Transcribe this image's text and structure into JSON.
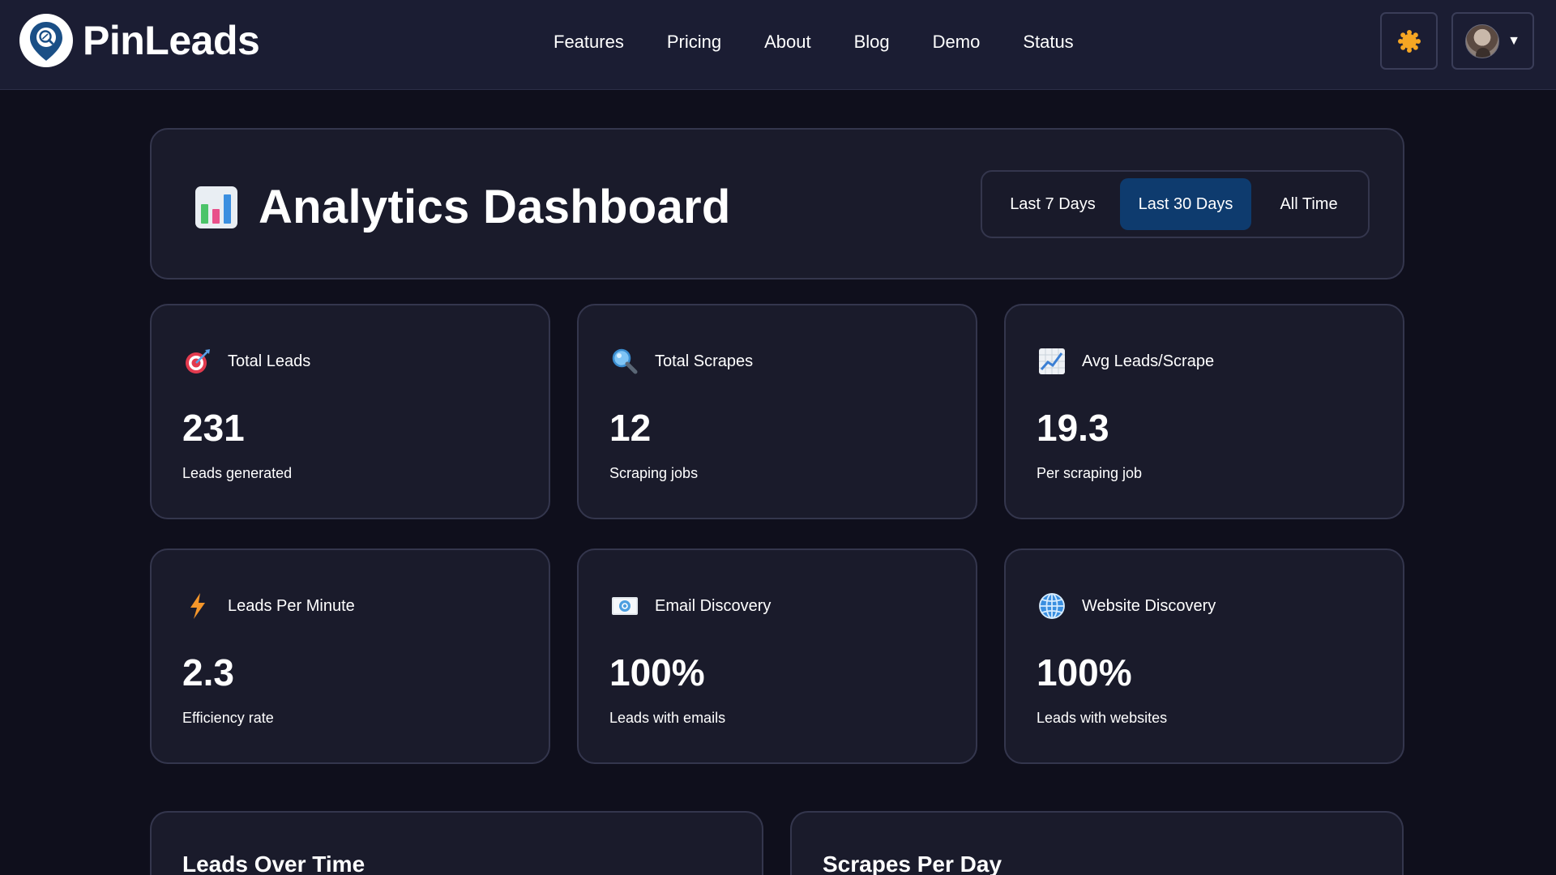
{
  "brand": {
    "name": "PinLeads",
    "logo_icon": "map-pin-search-icon"
  },
  "nav": {
    "links": [
      "Features",
      "Pricing",
      "About",
      "Blog",
      "Demo",
      "Status"
    ]
  },
  "header_actions": {
    "theme_icon": "sun-icon",
    "user_menu_icon": "chevron-down-icon",
    "caret": "▼"
  },
  "dashboard": {
    "title": "Analytics Dashboard",
    "title_icon": "bar-chart-icon",
    "ranges": [
      "Last 7 Days",
      "Last 30 Days",
      "All Time"
    ],
    "active_range": "Last 30 Days"
  },
  "stats": [
    {
      "icon": "target-icon",
      "label": "Total Leads",
      "value": "231",
      "sub": "Leads generated"
    },
    {
      "icon": "magnifier-icon",
      "label": "Total Scrapes",
      "value": "12",
      "sub": "Scraping jobs"
    },
    {
      "icon": "trend-chart-icon",
      "label": "Avg Leads/Scrape",
      "value": "19.3",
      "sub": "Per scraping job"
    },
    {
      "icon": "lightning-icon",
      "label": "Leads Per Minute",
      "value": "2.3",
      "sub": "Efficiency rate"
    },
    {
      "icon": "email-icon",
      "label": "Email Discovery",
      "value": "100%",
      "sub": "Leads with emails"
    },
    {
      "icon": "globe-icon",
      "label": "Website Discovery",
      "value": "100%",
      "sub": "Leads with websites"
    }
  ],
  "charts": [
    {
      "title": "Leads Over Time"
    },
    {
      "title": "Scrapes Per Day"
    }
  ],
  "colors": {
    "background": "#0f0f1c",
    "navbar": "#1b1d33",
    "card": "#1a1b2b",
    "card_border": "#34364d",
    "active_range": "#0e3b6e",
    "accent_sun": "#f5a623"
  }
}
